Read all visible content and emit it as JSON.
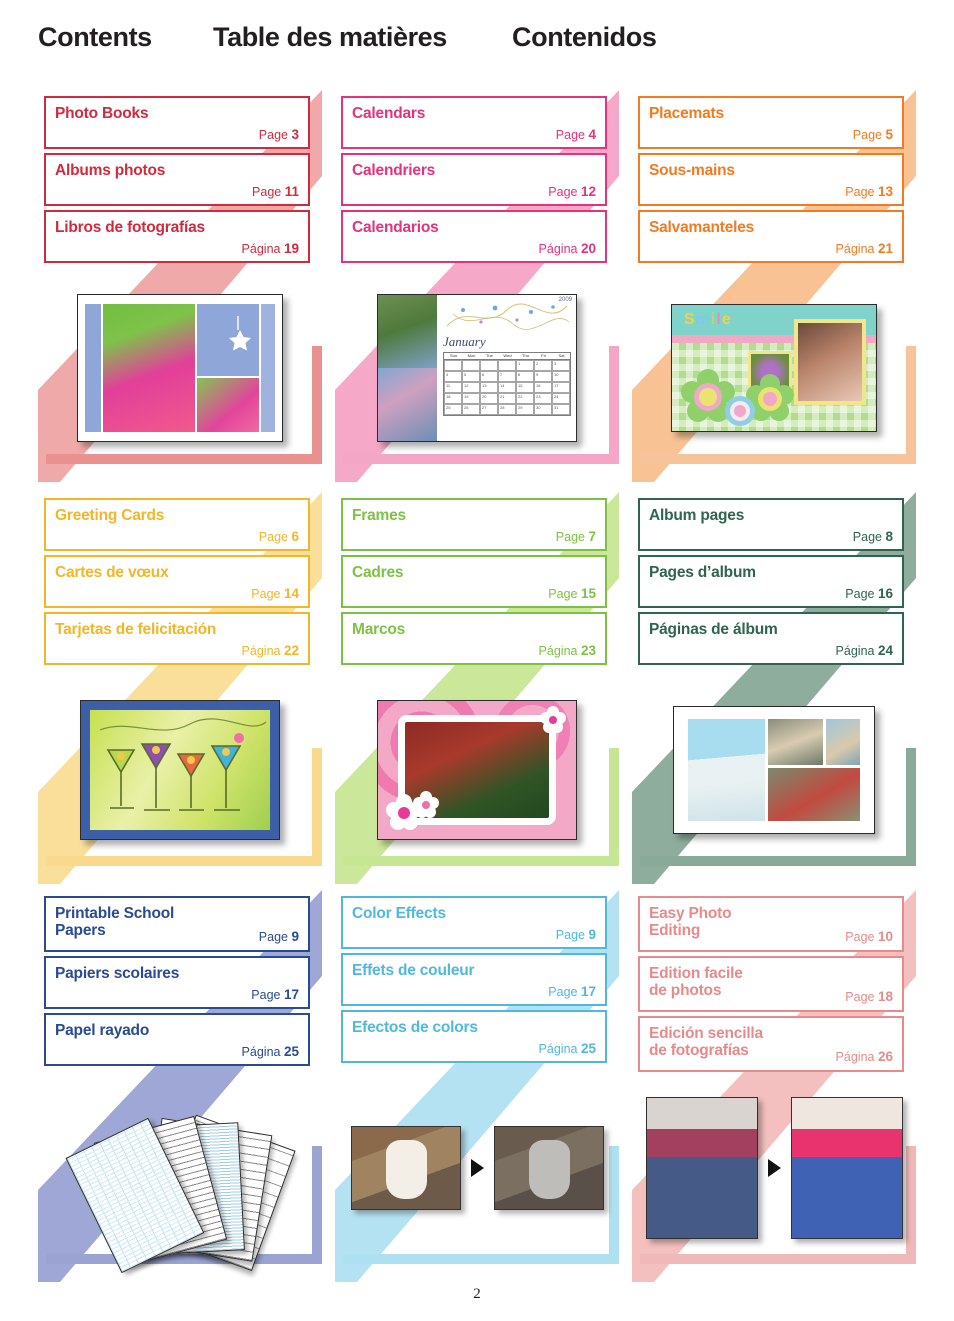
{
  "header": {
    "title_en": "Contents",
    "title_fr": "Table des matières",
    "title_es": "Contenidos"
  },
  "footer": {
    "page_number": "2"
  },
  "labels": {
    "page_en": "Page",
    "page_fr": "Page",
    "page_es": "Página"
  },
  "blocks": [
    {
      "id": "photo-books",
      "color": "#d12a3e",
      "band": "#f0a9a9",
      "accent": "#e8918f",
      "entries": [
        {
          "title": "Photo Books",
          "page_label": "Page",
          "page": "3"
        },
        {
          "title": "Albums photos",
          "page_label": "Page",
          "page": "11"
        },
        {
          "title": "Libros de fotografías",
          "page_label": "Página",
          "page": "19"
        }
      ],
      "thumb": "photo-book-collage"
    },
    {
      "id": "calendars",
      "color": "#e6317c",
      "band": "#f6a8c8",
      "accent": "#f4a6c6",
      "entries": [
        {
          "title": "Calendars",
          "page_label": "Page",
          "page": "4"
        },
        {
          "title": "Calendriers",
          "page_label": "Page",
          "page": "12"
        },
        {
          "title": "Calendarios",
          "page_label": "Página",
          "page": "20"
        }
      ],
      "thumb": "calendar-january",
      "thumb_text": {
        "month": "January",
        "year": "2009",
        "weekdays": [
          "Sun",
          "Mon",
          "Tue",
          "Wed",
          "Thu",
          "Fri",
          "Sat"
        ]
      }
    },
    {
      "id": "placemats",
      "color": "#f47a21",
      "band": "#f8c295",
      "accent": "#f7c39a",
      "entries": [
        {
          "title": "Placemats",
          "page_label": "Page",
          "page": "5"
        },
        {
          "title": "Sous-mains",
          "page_label": "Page",
          "page": "13"
        },
        {
          "title": "Salvamanteles",
          "page_label": "Página",
          "page": "21"
        }
      ],
      "thumb": "placemat-smile",
      "thumb_text": {
        "word": "Smile"
      }
    },
    {
      "id": "greeting-cards",
      "color": "#f2b626",
      "band": "#fadf9a",
      "accent": "#f8d98e",
      "entries": [
        {
          "title": "Greeting Cards",
          "page_label": "Page",
          "page": "6"
        },
        {
          "title": "Cartes de vœux",
          "page_label": "Page",
          "page": "14"
        },
        {
          "title": "Tarjetas de felicitación",
          "page_label": "Página",
          "page": "22"
        }
      ],
      "thumb": "greeting-card-cocktails"
    },
    {
      "id": "frames",
      "color": "#7cc242",
      "band": "#cbe79a",
      "accent": "#c6e694",
      "entries": [
        {
          "title": "Frames",
          "page_label": "Page",
          "page": "7"
        },
        {
          "title": "Cadres",
          "page_label": "Page",
          "page": "15"
        },
        {
          "title": "Marcos",
          "page_label": "Página",
          "page": "23"
        }
      ],
      "thumb": "frame-wedding"
    },
    {
      "id": "album-pages",
      "color": "#2e6450",
      "band": "#8fad9c",
      "accent": "#8aaa99",
      "entries": [
        {
          "title": "Album pages",
          "page_label": "Page",
          "page": "8"
        },
        {
          "title": "Pages d’album",
          "page_label": "Page",
          "page": "16"
        },
        {
          "title": "Páginas de álbum",
          "page_label": "Página",
          "page": "24"
        }
      ],
      "thumb": "album-page-beach"
    },
    {
      "id": "printable-school-papers",
      "color": "#2a4a93",
      "band": "#9fa7d6",
      "accent": "#9aa3d2",
      "entries": [
        {
          "title": "Printable School\nPapers",
          "page_label": "Page",
          "page": "9",
          "two_line": true
        },
        {
          "title": "Papiers scolaires",
          "page_label": "Page",
          "page": "17"
        },
        {
          "title": "Papel rayado",
          "page_label": "Página",
          "page": "25"
        }
      ],
      "thumb": "school-papers-fan"
    },
    {
      "id": "color-effects",
      "color": "#4fb8e0",
      "band": "#b5e2f2",
      "accent": "#ade0f0",
      "entries": [
        {
          "title": "Color Effects",
          "page_label": "Page",
          "page": "9"
        },
        {
          "title": "Effets de couleur",
          "page_label": "Page",
          "page": "17"
        },
        {
          "title": "Efectos de colors",
          "page_label": "Página",
          "page": "25"
        }
      ],
      "thumb": "vase-before-after"
    },
    {
      "id": "easy-photo-editing",
      "color": "#e98a8a",
      "band": "#f3bfbf",
      "accent": "#f0b9b9",
      "entries": [
        {
          "title": "Easy Photo\nEditing",
          "page_label": "Page",
          "page": "10",
          "two_line": true
        },
        {
          "title": "Edition facile\nde photos",
          "page_label": "Page",
          "page": "18",
          "two_line": true
        },
        {
          "title": "Edición sencilla\nde fotografías",
          "page_label": "Página",
          "page": "26",
          "two_line": true
        }
      ],
      "thumb": "kid-before-after"
    }
  ]
}
